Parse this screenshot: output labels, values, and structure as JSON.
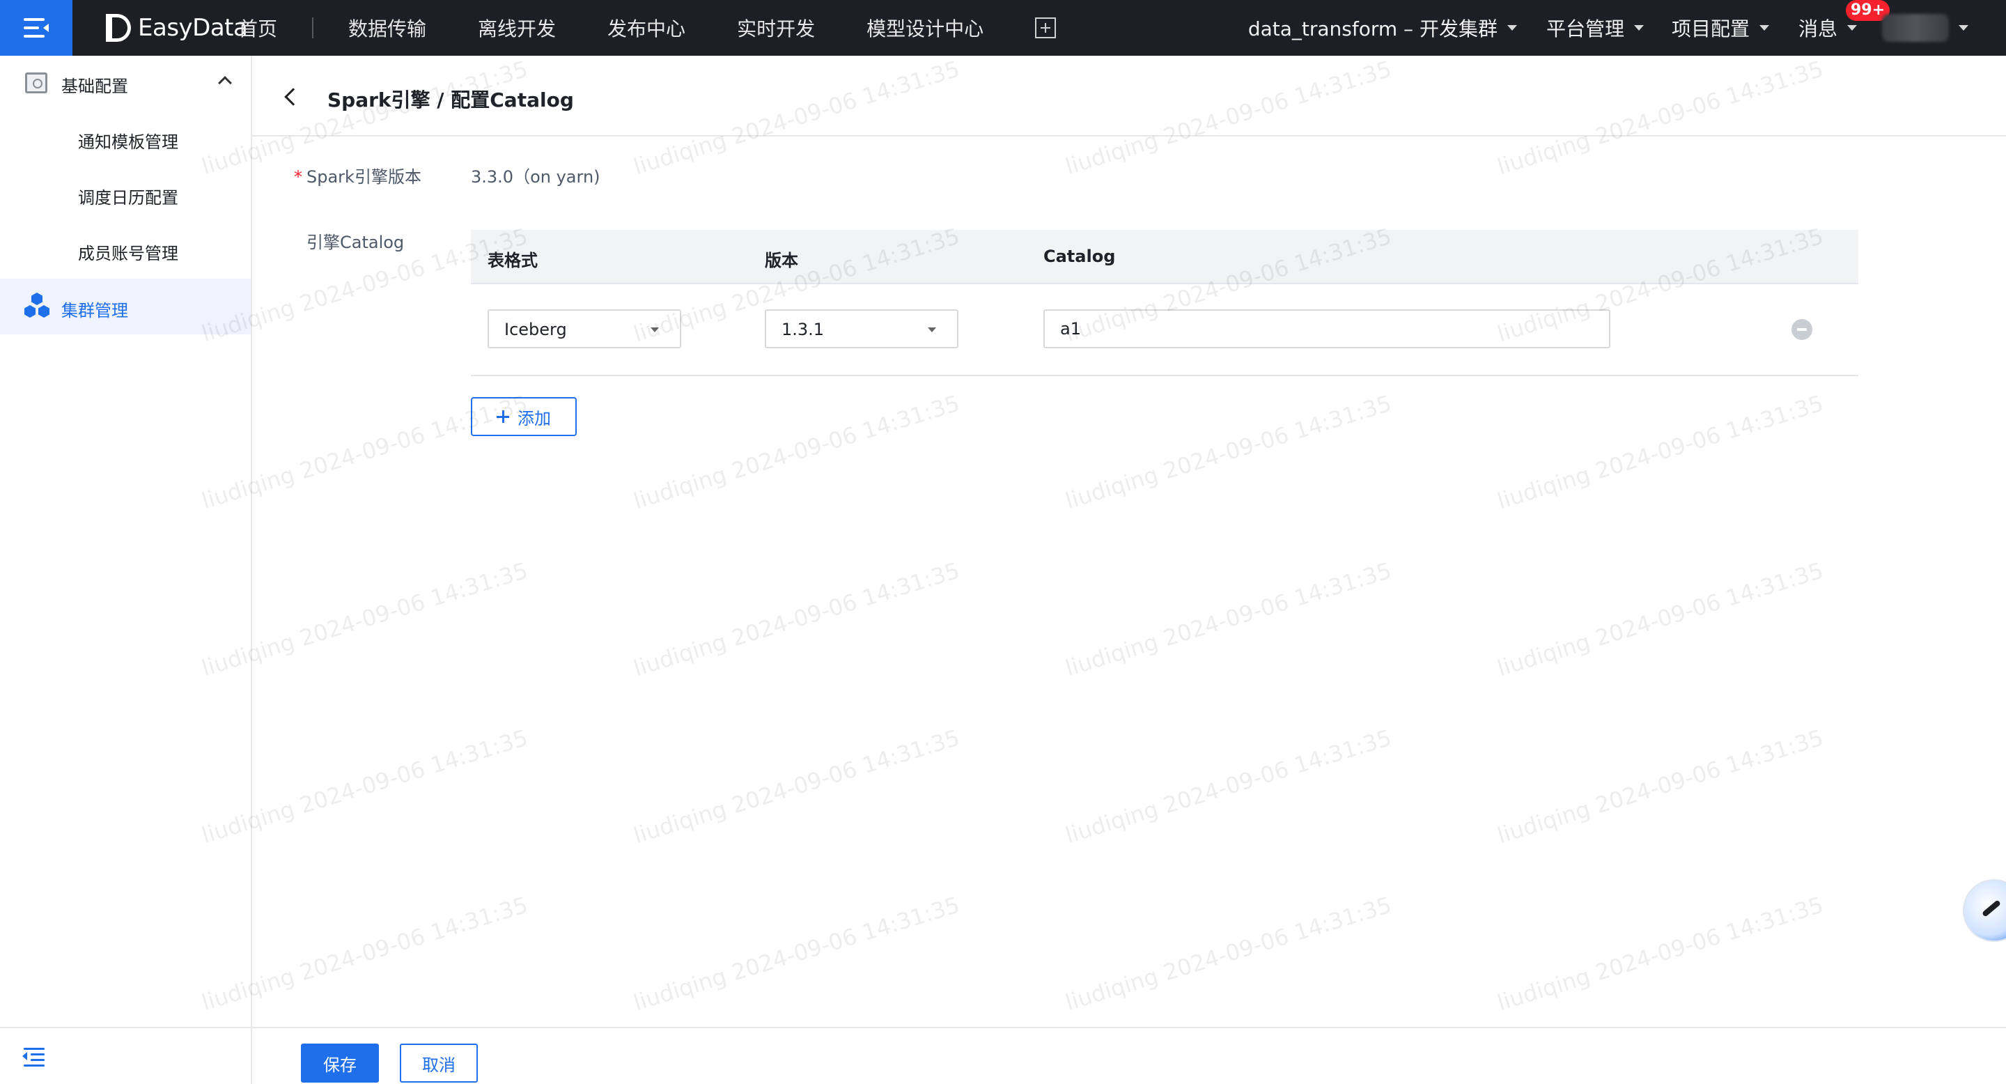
{
  "topnav": {
    "logo_text": "EasyData",
    "items": [
      "首页",
      "数据传输",
      "离线开发",
      "发布中心",
      "实时开发",
      "模型设计中心"
    ],
    "project": "data_transform – 开发集群",
    "platform": "平台管理",
    "project_config": "项目配置",
    "messages": "消息",
    "message_badge": "99+"
  },
  "sidebar": {
    "group_label": "基础配置",
    "sub_items": [
      "通知模板管理",
      "调度日历配置",
      "成员账号管理"
    ],
    "active_item": "集群管理"
  },
  "page": {
    "title": "Spark引擎 / 配置Catalog",
    "version_label": "Spark引擎版本",
    "version_value": "3.3.0（on yarn)",
    "catalog_label": "引擎Catalog",
    "table": {
      "headers": [
        "表格式",
        "版本",
        "Catalog"
      ],
      "rows": [
        {
          "format": "Iceberg",
          "version": "1.3.1",
          "catalog": "a1"
        }
      ]
    },
    "add_label": "添加",
    "save_label": "保存",
    "cancel_label": "取消"
  },
  "watermark": "liudiqing 2024-09-06 14:31:35",
  "colors": {
    "primary": "#1f6feb",
    "topnav_bg": "#1d1f24",
    "badge": "#f5222d"
  }
}
